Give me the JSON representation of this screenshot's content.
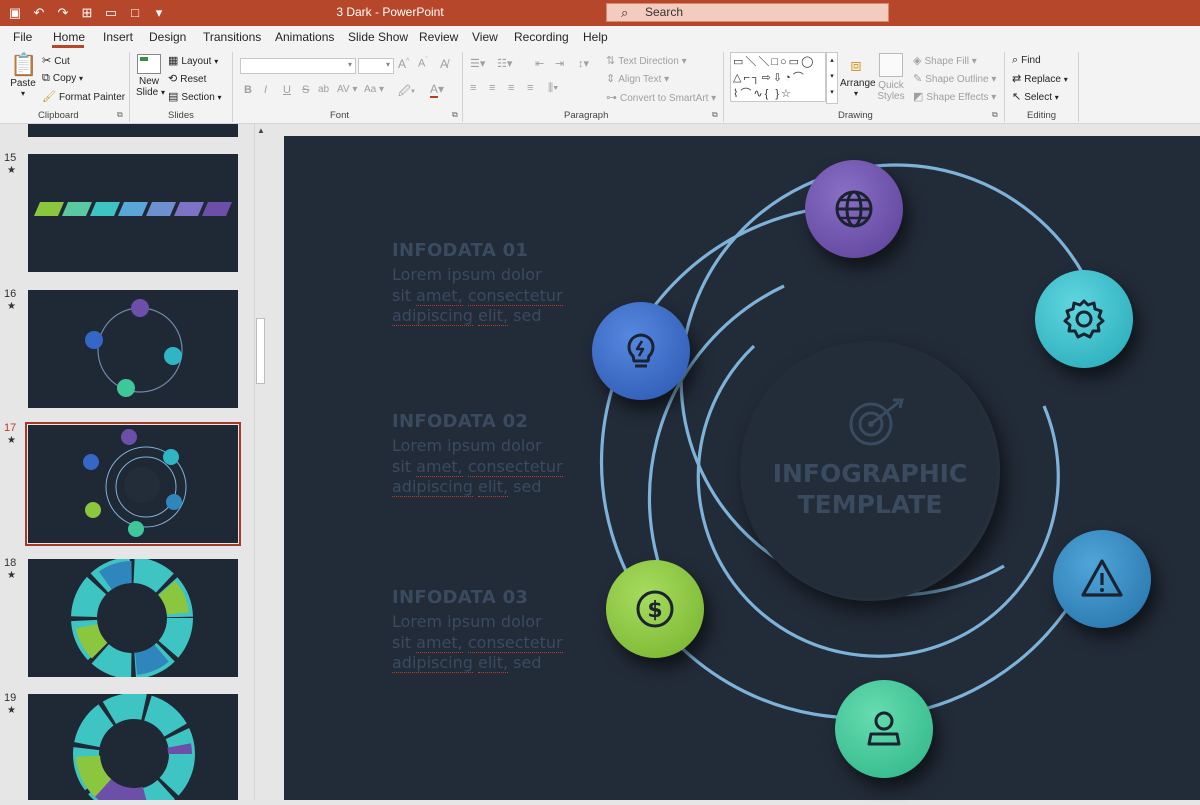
{
  "window": {
    "title": "3 Dark  -  PowerPoint",
    "search_label": "Search"
  },
  "tabs": [
    "File",
    "Home",
    "Insert",
    "Design",
    "Transitions",
    "Animations",
    "Slide Show",
    "Review",
    "View",
    "Recording",
    "Help"
  ],
  "active_tab": "Home",
  "ribbon": {
    "clipboard": {
      "label": "Clipboard",
      "paste": "Paste",
      "cut": "Cut",
      "copy": "Copy",
      "format_painter": "Format Painter"
    },
    "slides": {
      "label": "Slides",
      "new_slide_1": "New",
      "new_slide_2": "Slide",
      "layout": "Layout",
      "reset": "Reset",
      "section": "Section"
    },
    "font": {
      "label": "Font",
      "bold": "B",
      "italic": "I",
      "underline": "U",
      "strike": "S",
      "case": "Aa"
    },
    "paragraph": {
      "label": "Paragraph",
      "text_direction": "Text Direction",
      "align_text": "Align Text",
      "convert_smartart": "Convert to SmartArt"
    },
    "drawing": {
      "label": "Drawing",
      "arrange": "Arrange",
      "quick_1": "Quick",
      "quick_2": "Styles",
      "shape_fill": "Shape Fill",
      "shape_outline": "Shape Outline",
      "shape_effects": "Shape Effects"
    },
    "editing": {
      "label": "Editing",
      "find": "Find",
      "replace": "Replace",
      "select": "Select"
    }
  },
  "thumbnails": [
    {
      "num": "15",
      "star": "★"
    },
    {
      "num": "16",
      "star": "★"
    },
    {
      "num": "17",
      "star": "★",
      "selected": true
    },
    {
      "num": "18",
      "star": "★"
    },
    {
      "num": "19",
      "star": "★"
    }
  ],
  "slide": {
    "items": [
      {
        "heading": "INFODATA 01",
        "l1a": "Lorem ipsum dolor",
        "l2a": "sit ",
        "l2b": "amet,",
        "l2c": " ",
        "l2d": "consectetur",
        "l3a": "adipiscing",
        "l3b": " ",
        "l3c": "elit,",
        "l3d": " sed"
      },
      {
        "heading": "INFODATA 02",
        "l1a": "Lorem ipsum dolor",
        "l2a": "sit ",
        "l2b": "amet,",
        "l2c": " ",
        "l2d": "consectetur",
        "l3a": "adipiscing",
        "l3b": " ",
        "l3c": "elit,",
        "l3d": " sed"
      },
      {
        "heading": "INFODATA 03",
        "l1a": "Lorem ipsum dolor",
        "l2a": "sit ",
        "l2b": "amet,",
        "l2c": " ",
        "l2d": "consectetur",
        "l3a": "adipiscing",
        "l3b": " ",
        "l3c": "elit,",
        "l3d": " sed"
      }
    ],
    "center_title_1": "INFOGRAPHIC",
    "center_title_2": "TEMPLATE",
    "nodes": [
      {
        "icon": "globe-icon",
        "color": "#6b4fa8"
      },
      {
        "icon": "gear-icon",
        "color": "#2fb5c4"
      },
      {
        "icon": "warning-icon",
        "color": "#2f86bd"
      },
      {
        "icon": "user-icon",
        "color": "#3fc79a"
      },
      {
        "icon": "dollar-icon",
        "color": "#8bc63f"
      },
      {
        "icon": "lightbulb-icon",
        "color": "#3568c6"
      }
    ]
  }
}
